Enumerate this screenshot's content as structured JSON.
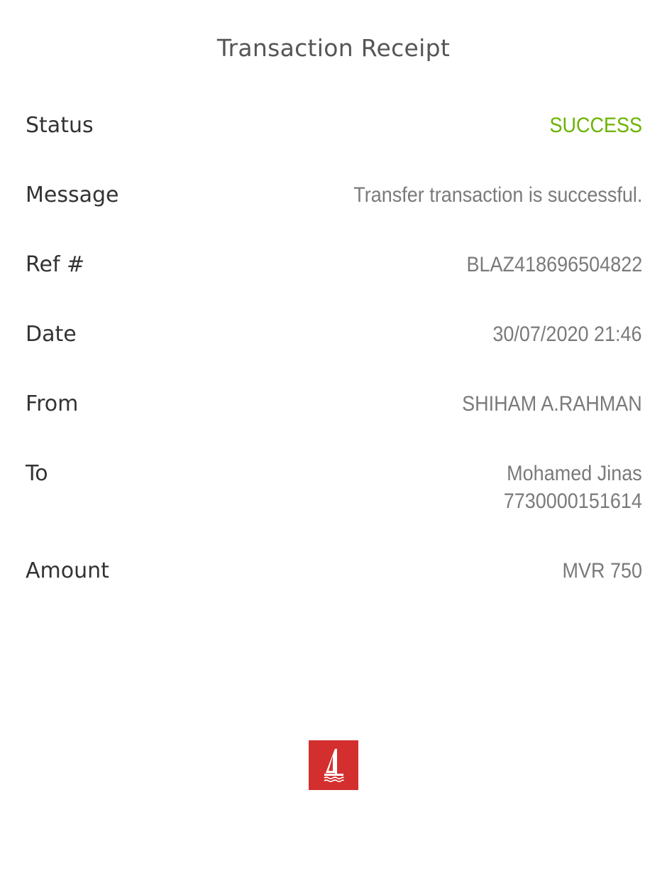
{
  "header": {
    "title": "Transaction Receipt"
  },
  "receipt": {
    "status": {
      "label": "Status",
      "value": "SUCCESS"
    },
    "message": {
      "label": "Message",
      "value": "Transfer transaction is successful."
    },
    "ref": {
      "label": "Ref #",
      "value": "BLAZ418696504822"
    },
    "date": {
      "label": "Date",
      "value": "30/07/2020 21:46"
    },
    "from": {
      "label": "From",
      "value": "SHIHAM A.RAHMAN"
    },
    "to": {
      "label": "To",
      "name": "Mohamed Jinas",
      "account": "7730000151614"
    },
    "amount": {
      "label": "Amount",
      "value": "MVR 750"
    }
  },
  "colors": {
    "success": "#6bb300",
    "logo_background": "#d32f2f"
  },
  "logo": {
    "icon": "sailboat-icon"
  }
}
